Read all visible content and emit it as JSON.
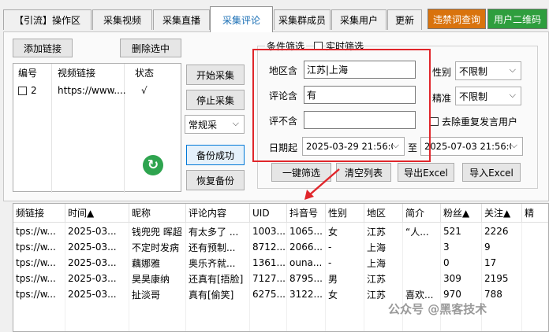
{
  "tabs": [
    {
      "label": "【引流】操作区",
      "active": false
    },
    {
      "label": "采集视频",
      "active": false
    },
    {
      "label": "采集直播",
      "active": false
    },
    {
      "label": "采集评论",
      "active": true
    },
    {
      "label": "采集群成员",
      "active": false
    },
    {
      "label": "采集用户",
      "active": false
    },
    {
      "label": "更新",
      "active": false
    }
  ],
  "tab_buttons": [
    {
      "label": "违禁词查询",
      "color": "#d9730d"
    },
    {
      "label": "用户二维码",
      "color": "#2e9e3e"
    }
  ],
  "left": {
    "add_link": "添加链接",
    "delete_selected": "删除选中",
    "columns": [
      "编号",
      "视频链接",
      "状态"
    ],
    "rows": [
      {
        "num": "2",
        "url": "https://www....",
        "status": "√"
      }
    ]
  },
  "mid": {
    "start": "开始采集",
    "stop": "停止采集",
    "mode": "常规采",
    "backup_ok": "备份成功",
    "restore": "恢复备份"
  },
  "filter": {
    "group_title": "条件筛选",
    "realtime": "实时筛选",
    "region_label": "地区含",
    "region_value": "江苏|上海",
    "comment_label": "评论含",
    "comment_value": "有",
    "exclude_label": "评不含",
    "exclude_value": "",
    "date_label": "日期起",
    "date_from": "2025-03-29 21:56:0",
    "to_label": "至",
    "date_to": "2025-07-03 21:56:0",
    "gender_label": "性别",
    "gender_value": "不限制",
    "accuracy_label": "精准",
    "accuracy_value": "不限制",
    "dedupe_label": "去除重复发言用户",
    "one_click": "一键筛选",
    "clear_list": "清空列表",
    "export_excel": "导出Excel",
    "import_excel": "导入Excel"
  },
  "grid": {
    "columns": [
      "频链接",
      "时间▲",
      "昵称",
      "评论内容",
      "UID",
      "抖音号",
      "性别",
      "地区",
      "简介",
      "粉丝▲",
      "关注▲",
      "精"
    ],
    "rows": [
      [
        "tps://w...",
        "2025-03...",
        "钱兜兜 晖超",
        "有太多了 ...",
        "1003...",
        "1065...",
        "女",
        "江苏",
        "“人...",
        "521",
        "2226"
      ],
      [
        "tps://w...",
        "2025-03...",
        "不定时发病",
        "还有预制...",
        "8712...",
        "2066...",
        "-",
        "上海",
        "",
        "3",
        "9"
      ],
      [
        "tps://w...",
        "2025-03...",
        "藕娜雅",
        "奥乐齐就...",
        "1361...",
        "ouna...",
        "-",
        "上海",
        "",
        "0",
        "17"
      ],
      [
        "tps://w...",
        "2025-03...",
        "昊昊康纳",
        "还真有[捂脸]",
        "7127...",
        "8795...",
        "男",
        "江苏",
        "",
        "309",
        "2195"
      ],
      [
        "tps://w...",
        "2025-03...",
        "扯淡哥",
        "真有[偷笑]",
        "6275...",
        "3122...",
        "女",
        "江苏",
        "喜欢...",
        "970",
        "788"
      ]
    ]
  },
  "watermark": "公众号 @黑客技术"
}
